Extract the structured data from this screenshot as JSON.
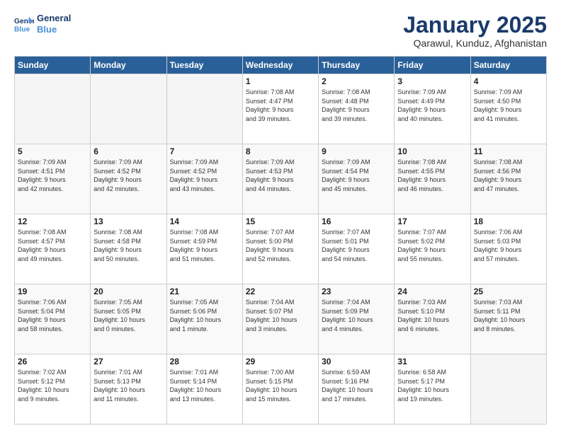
{
  "logo": {
    "line1": "General",
    "line2": "Blue"
  },
  "title": "January 2025",
  "subtitle": "Qarawul, Kunduz, Afghanistan",
  "headers": [
    "Sunday",
    "Monday",
    "Tuesday",
    "Wednesday",
    "Thursday",
    "Friday",
    "Saturday"
  ],
  "weeks": [
    [
      {
        "day": "",
        "info": ""
      },
      {
        "day": "",
        "info": ""
      },
      {
        "day": "",
        "info": ""
      },
      {
        "day": "1",
        "info": "Sunrise: 7:08 AM\nSunset: 4:47 PM\nDaylight: 9 hours\nand 39 minutes."
      },
      {
        "day": "2",
        "info": "Sunrise: 7:08 AM\nSunset: 4:48 PM\nDaylight: 9 hours\nand 39 minutes."
      },
      {
        "day": "3",
        "info": "Sunrise: 7:09 AM\nSunset: 4:49 PM\nDaylight: 9 hours\nand 40 minutes."
      },
      {
        "day": "4",
        "info": "Sunrise: 7:09 AM\nSunset: 4:50 PM\nDaylight: 9 hours\nand 41 minutes."
      }
    ],
    [
      {
        "day": "5",
        "info": "Sunrise: 7:09 AM\nSunset: 4:51 PM\nDaylight: 9 hours\nand 42 minutes."
      },
      {
        "day": "6",
        "info": "Sunrise: 7:09 AM\nSunset: 4:52 PM\nDaylight: 9 hours\nand 42 minutes."
      },
      {
        "day": "7",
        "info": "Sunrise: 7:09 AM\nSunset: 4:52 PM\nDaylight: 9 hours\nand 43 minutes."
      },
      {
        "day": "8",
        "info": "Sunrise: 7:09 AM\nSunset: 4:53 PM\nDaylight: 9 hours\nand 44 minutes."
      },
      {
        "day": "9",
        "info": "Sunrise: 7:09 AM\nSunset: 4:54 PM\nDaylight: 9 hours\nand 45 minutes."
      },
      {
        "day": "10",
        "info": "Sunrise: 7:08 AM\nSunset: 4:55 PM\nDaylight: 9 hours\nand 46 minutes."
      },
      {
        "day": "11",
        "info": "Sunrise: 7:08 AM\nSunset: 4:56 PM\nDaylight: 9 hours\nand 47 minutes."
      }
    ],
    [
      {
        "day": "12",
        "info": "Sunrise: 7:08 AM\nSunset: 4:57 PM\nDaylight: 9 hours\nand 49 minutes."
      },
      {
        "day": "13",
        "info": "Sunrise: 7:08 AM\nSunset: 4:58 PM\nDaylight: 9 hours\nand 50 minutes."
      },
      {
        "day": "14",
        "info": "Sunrise: 7:08 AM\nSunset: 4:59 PM\nDaylight: 9 hours\nand 51 minutes."
      },
      {
        "day": "15",
        "info": "Sunrise: 7:07 AM\nSunset: 5:00 PM\nDaylight: 9 hours\nand 52 minutes."
      },
      {
        "day": "16",
        "info": "Sunrise: 7:07 AM\nSunset: 5:01 PM\nDaylight: 9 hours\nand 54 minutes."
      },
      {
        "day": "17",
        "info": "Sunrise: 7:07 AM\nSunset: 5:02 PM\nDaylight: 9 hours\nand 55 minutes."
      },
      {
        "day": "18",
        "info": "Sunrise: 7:06 AM\nSunset: 5:03 PM\nDaylight: 9 hours\nand 57 minutes."
      }
    ],
    [
      {
        "day": "19",
        "info": "Sunrise: 7:06 AM\nSunset: 5:04 PM\nDaylight: 9 hours\nand 58 minutes."
      },
      {
        "day": "20",
        "info": "Sunrise: 7:05 AM\nSunset: 5:05 PM\nDaylight: 10 hours\nand 0 minutes."
      },
      {
        "day": "21",
        "info": "Sunrise: 7:05 AM\nSunset: 5:06 PM\nDaylight: 10 hours\nand 1 minute."
      },
      {
        "day": "22",
        "info": "Sunrise: 7:04 AM\nSunset: 5:07 PM\nDaylight: 10 hours\nand 3 minutes."
      },
      {
        "day": "23",
        "info": "Sunrise: 7:04 AM\nSunset: 5:09 PM\nDaylight: 10 hours\nand 4 minutes."
      },
      {
        "day": "24",
        "info": "Sunrise: 7:03 AM\nSunset: 5:10 PM\nDaylight: 10 hours\nand 6 minutes."
      },
      {
        "day": "25",
        "info": "Sunrise: 7:03 AM\nSunset: 5:11 PM\nDaylight: 10 hours\nand 8 minutes."
      }
    ],
    [
      {
        "day": "26",
        "info": "Sunrise: 7:02 AM\nSunset: 5:12 PM\nDaylight: 10 hours\nand 9 minutes."
      },
      {
        "day": "27",
        "info": "Sunrise: 7:01 AM\nSunset: 5:13 PM\nDaylight: 10 hours\nand 11 minutes."
      },
      {
        "day": "28",
        "info": "Sunrise: 7:01 AM\nSunset: 5:14 PM\nDaylight: 10 hours\nand 13 minutes."
      },
      {
        "day": "29",
        "info": "Sunrise: 7:00 AM\nSunset: 5:15 PM\nDaylight: 10 hours\nand 15 minutes."
      },
      {
        "day": "30",
        "info": "Sunrise: 6:59 AM\nSunset: 5:16 PM\nDaylight: 10 hours\nand 17 minutes."
      },
      {
        "day": "31",
        "info": "Sunrise: 6:58 AM\nSunset: 5:17 PM\nDaylight: 10 hours\nand 19 minutes."
      },
      {
        "day": "",
        "info": ""
      }
    ]
  ]
}
